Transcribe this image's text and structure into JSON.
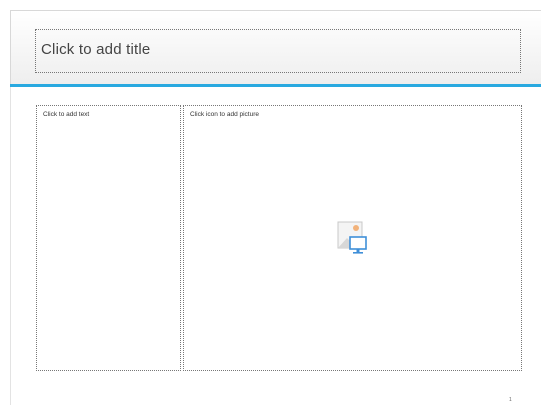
{
  "slide": {
    "title_placeholder": "Click to add title",
    "text_placeholder": "Click to add text",
    "picture_placeholder": "Click icon to add picture",
    "picture_icon": "insert-picture-icon",
    "slide_number": "1"
  },
  "colors": {
    "accent": "#29a9e0",
    "placeholder_border": "#777777",
    "header_gradient_bottom": "#eeeeee"
  }
}
